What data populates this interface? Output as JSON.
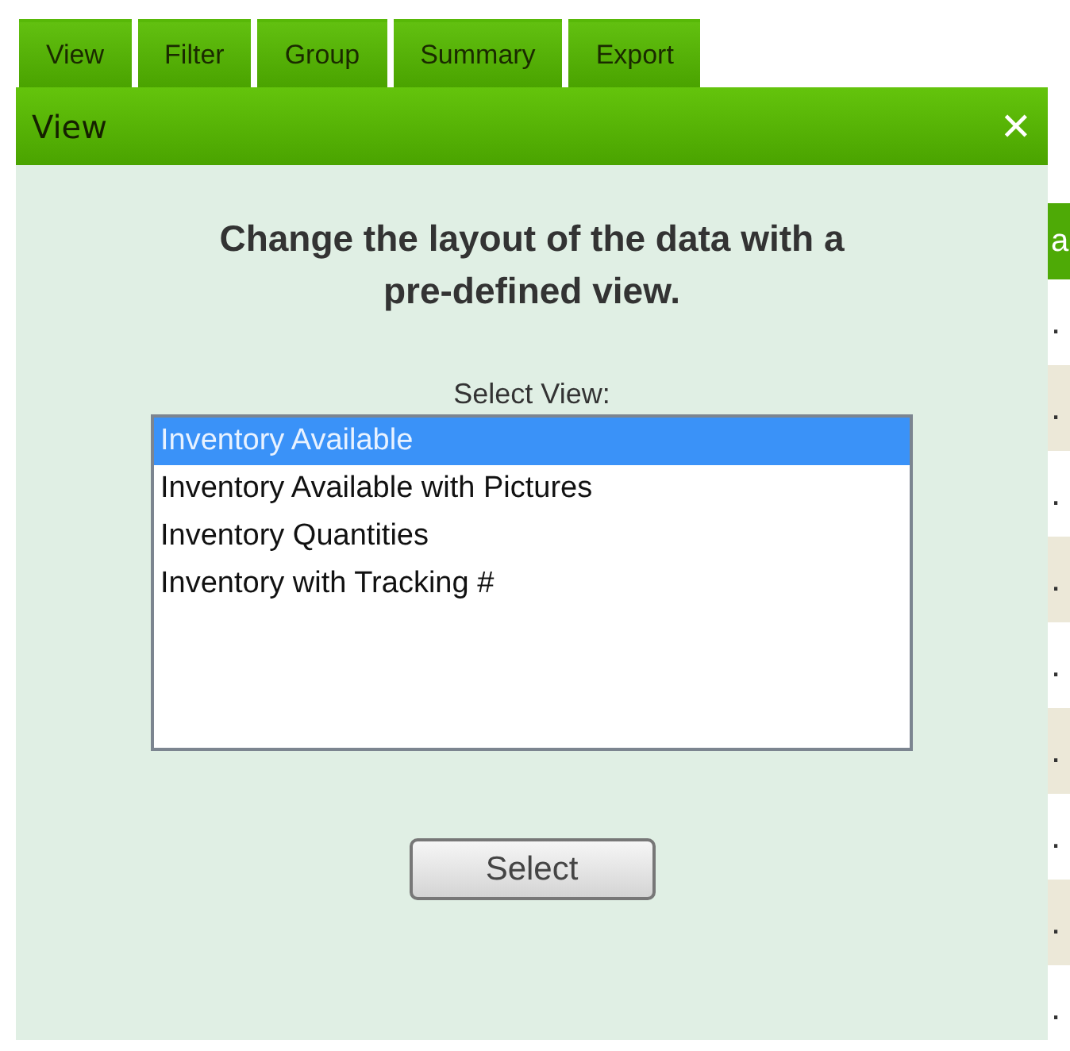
{
  "tabs": [
    {
      "label": "View"
    },
    {
      "label": "Filter"
    },
    {
      "label": "Group"
    },
    {
      "label": "Summary"
    },
    {
      "label": "Export"
    }
  ],
  "table": {
    "column_1_header": "a",
    "rows": [
      ".",
      ".",
      ".",
      ".",
      ".",
      ".",
      ".",
      ".",
      "."
    ]
  },
  "dialog": {
    "title": "View",
    "close": "✕",
    "heading": "Change the layout of the data with a pre-defined view.",
    "list_label": "Select View:",
    "options": [
      {
        "label": "Inventory Available",
        "selected": true
      },
      {
        "label": "Inventory Available with Pictures",
        "selected": false
      },
      {
        "label": "Inventory Quantities",
        "selected": false
      },
      {
        "label": "Inventory with Tracking #",
        "selected": false
      }
    ],
    "button": "Select"
  }
}
